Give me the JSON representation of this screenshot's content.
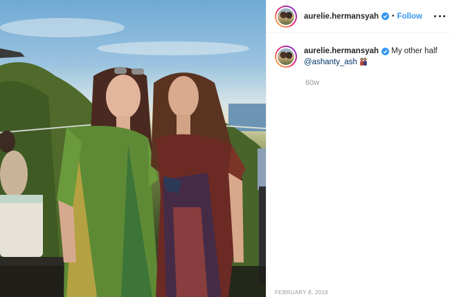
{
  "post": {
    "username": "aurelie.hermansyah",
    "verified": true,
    "follow_label": "Follow",
    "separator": "•",
    "more_icon": "more-horizontal-icon",
    "caption": {
      "username": "aurelie.hermansyah",
      "text": "My other half",
      "mention": "@ashanty_ash",
      "emoji": "two-women-emoji"
    },
    "age": "60w",
    "date": "FEBRUARY 8, 2018"
  },
  "colors": {
    "link": "#3897f0",
    "mention": "#003569",
    "muted": "#999999",
    "text": "#262626"
  }
}
